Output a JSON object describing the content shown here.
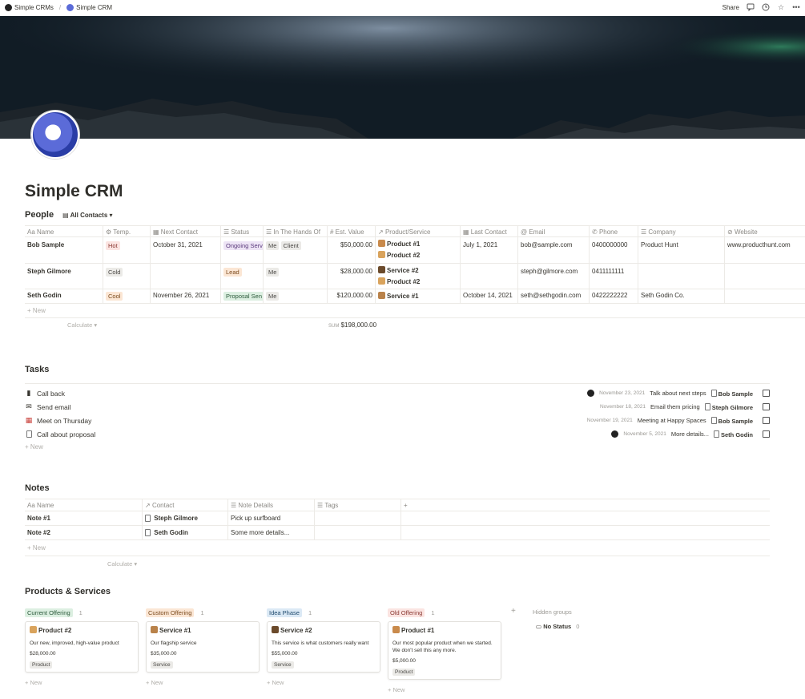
{
  "topbar": {
    "breadcrumbs": [
      "Simple CRMs",
      "Simple CRM"
    ],
    "share_label": "Share"
  },
  "page": {
    "title": "Simple CRM"
  },
  "people": {
    "title": "People",
    "view_label": "All Contacts",
    "columns": [
      "Name",
      "Temp.",
      "Next Contact",
      "Status",
      "In The Hands Of",
      "Est. Value",
      "Product/Service",
      "Last Contact",
      "Email",
      "Phone",
      "Company",
      "Website"
    ],
    "rows": [
      {
        "name": "Bob Sample",
        "temp": "Hot",
        "next": "October 31, 2021",
        "status": "Ongoing Serv",
        "hands": [
          "Me",
          "Client"
        ],
        "value": "$50,000.00",
        "products": [
          "Product #1",
          "Product #2"
        ],
        "last": "July 1, 2021",
        "email": "bob@sample.com",
        "phone": "0400000000",
        "company": "Product Hunt",
        "website": "www.producthunt.com"
      },
      {
        "name": "Steph Gilmore",
        "temp": "Cold",
        "next": "",
        "status": "Lead",
        "hands": [
          "Me"
        ],
        "value": "$28,000.00",
        "products": [
          "Service #2",
          "Product #2"
        ],
        "last": "",
        "email": "steph@gilmore.com",
        "phone": "0411111111",
        "company": "",
        "website": ""
      },
      {
        "name": "Seth Godin",
        "temp": "Cool",
        "next": "November 26, 2021",
        "status": "Proposal Sen",
        "hands": [
          "Me"
        ],
        "value": "$120,000.00",
        "products": [
          "Service #1"
        ],
        "last": "October 14, 2021",
        "email": "seth@sethgodin.com",
        "phone": "0422222222",
        "company": "Seth Godin Co.",
        "website": ""
      }
    ],
    "new_label": "New",
    "calculate_label": "Calculate",
    "sum_prefix": "SUM",
    "sum_value": "$198,000.00"
  },
  "tasks": {
    "title": "Tasks",
    "items": [
      {
        "label": "Call back",
        "date": "November 23, 2021",
        "detail": "Talk about next steps",
        "contact": "Bob Sample"
      },
      {
        "label": "Send email",
        "date": "November 18, 2021",
        "detail": "Email them pricing",
        "contact": "Steph Gilmore"
      },
      {
        "label": "Meet on Thursday",
        "date": "November 19, 2021",
        "detail": "Meeting at Happy Spaces",
        "contact": "Bob Sample"
      },
      {
        "label": "Call about proposal",
        "date": "November 5, 2021",
        "detail": "More details...",
        "contact": "Seth Godin"
      }
    ],
    "new_label": "New"
  },
  "notes": {
    "title": "Notes",
    "columns": [
      "Name",
      "Contact",
      "Note Details",
      "Tags"
    ],
    "rows": [
      {
        "name": "Note #1",
        "contact": "Steph Gilmore",
        "details": "Pick up surfboard"
      },
      {
        "name": "Note #2",
        "contact": "Seth Godin",
        "details": "Some more details..."
      }
    ],
    "new_label": "New",
    "calculate_label": "Calculate"
  },
  "products": {
    "title": "Products & Services",
    "groups": [
      {
        "label": "Current Offering",
        "count": "1",
        "card": {
          "title": "Product #2",
          "desc": "Our new, improved, high-value product",
          "price": "$28,000.00",
          "tag": "Product"
        }
      },
      {
        "label": "Custom Offering",
        "count": "1",
        "card": {
          "title": "Service #1",
          "desc": "Our flagship service",
          "price": "$35,000.00",
          "tag": "Service"
        }
      },
      {
        "label": "Idea Phase",
        "count": "1",
        "card": {
          "title": "Service #2",
          "desc": "This service is what customers really want",
          "price": "$55,000.00",
          "tag": "Service"
        }
      },
      {
        "label": "Old Offering",
        "count": "1",
        "card": {
          "title": "Product #1",
          "desc": "Our most popular product when we started. We don't sell this any more.",
          "price": "$5,000.00",
          "tag": "Product"
        }
      }
    ],
    "hidden_groups_label": "Hidden groups",
    "no_status_label": "No Status",
    "no_status_count": "0",
    "new_label": "New"
  },
  "colors": {
    "text": "#37352f",
    "hot": "#fbe4e1",
    "cool": "#fbe6d4",
    "current_offering": "#dcefe1",
    "custom_offering": "#fbe6d4",
    "idea_phase": "#dbe9f5",
    "old_offering": "#fbe4e1"
  }
}
